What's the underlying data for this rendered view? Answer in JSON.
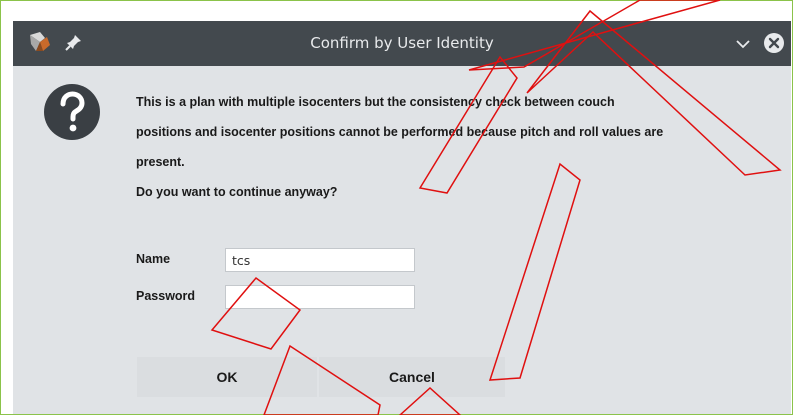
{
  "window": {
    "title": "Confirm by User Identity"
  },
  "message": {
    "line1": "This is a plan with multiple isocenters but the consistency check between couch",
    "line2": "positions and isocenter positions cannot be performed because pitch and roll values are",
    "line3": "present.",
    "line4": "Do you want to continue anyway?"
  },
  "form": {
    "name_label": "Name",
    "name_value": "tcs",
    "password_label": "Password",
    "password_value": ""
  },
  "buttons": {
    "ok_label": "OK",
    "cancel_label": "Cancel"
  },
  "icons": {
    "app": "app-logo-icon",
    "pin": "pin-icon",
    "chevron": "chevron-down-icon",
    "close": "close-icon",
    "question": "question-icon"
  },
  "colors": {
    "titlebar": "#43494e",
    "dialog_bg": "#e0e3e6",
    "frame_border": "#8bc34a",
    "watermark": "#e01010"
  }
}
